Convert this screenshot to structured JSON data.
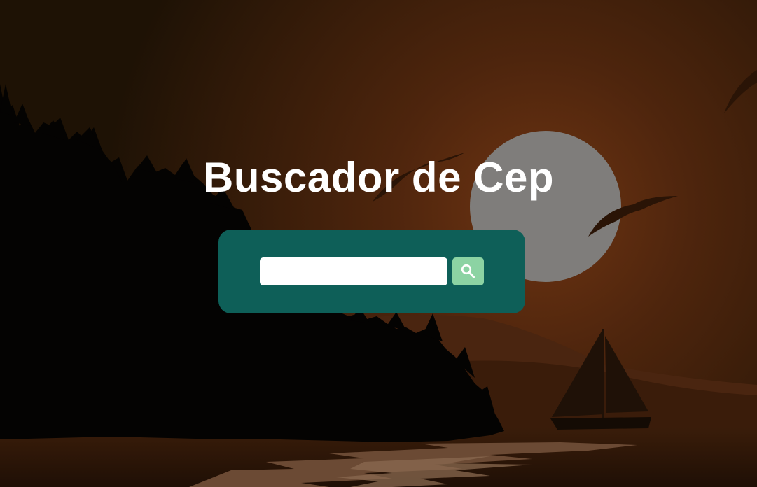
{
  "page": {
    "title": "Buscador de Cep"
  },
  "search": {
    "value": "",
    "placeholder": "",
    "button_icon": "search-icon"
  },
  "colors": {
    "panel": "#0e5f58",
    "button": "#8cd3a3",
    "title": "#ffffff"
  }
}
